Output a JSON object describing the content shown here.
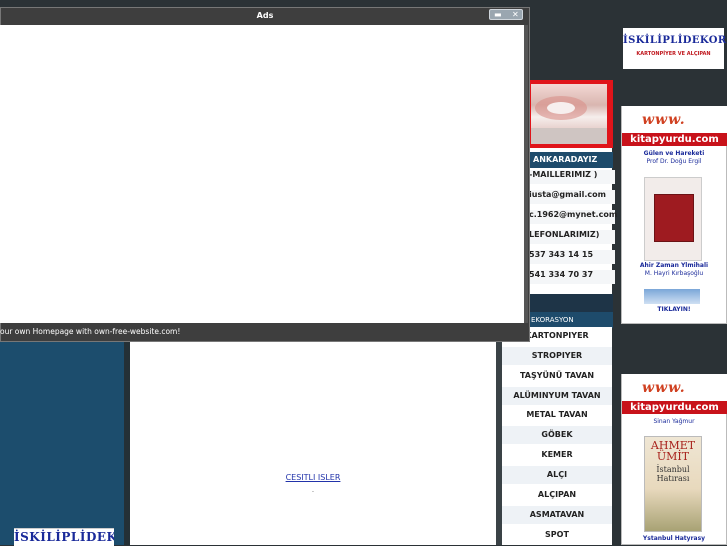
{
  "window": {
    "title": "Ads",
    "status_text": "our own Homepage with own-free-website.com!"
  },
  "site": {
    "top_logo": {
      "line1": "İSKİLİPLİDEKOR",
      "line2": "KARTONPİYER VE ALÇIPAN"
    },
    "bottom_logo": "İSKİLİPLİDEKOR",
    "cesitli_link": "CESITLI ISLER",
    "dot": ".",
    "ankara": "ANKARADAYIZ",
    "contacts": [
      "-MAILLERIMIZ )",
      "iusta@gmail.com",
      "c.1962@mynet.com",
      "LEFONLARIMIZ)",
      "537 343 14 15",
      "541 334 70 37"
    ],
    "dekor_head": "EKORASYON",
    "menu": [
      "KARTONPIYER",
      "STROPIYER",
      "TAŞYÜNÜ TAVAN",
      "ALÜMINYUM TAVAN",
      "METAL TAVAN",
      "GÖBEK",
      "KEMER",
      "ALÇI",
      "ALÇIPAN",
      "ASMATAVAN",
      "SPOT"
    ]
  },
  "ads": {
    "logo_www": "www.",
    "logo_bar": "kitapyurdu.com",
    "ad1": {
      "caption_top1": "Gülen ve Hareketi",
      "caption_top2": "Prof Dr. Doğu Ergil",
      "book_title": "Ahir Zaman Ylmihali",
      "book_author": "M. Hayri Kırbaşoğlu",
      "link": "TIKLAYIN!"
    },
    "ad2": {
      "caption_top": "Sinan Yağmur",
      "book_cover_line1": "AHMET",
      "book_cover_line2": "ÜMİT",
      "book_cover_line3": "İstanbul Hatırası",
      "book_title": "Ystanbul Hatyrasy"
    }
  },
  "colors": {
    "accent_red": "#c8121a",
    "menu_blue": "#1e4b6b",
    "link_blue": "#1a2a9a"
  }
}
